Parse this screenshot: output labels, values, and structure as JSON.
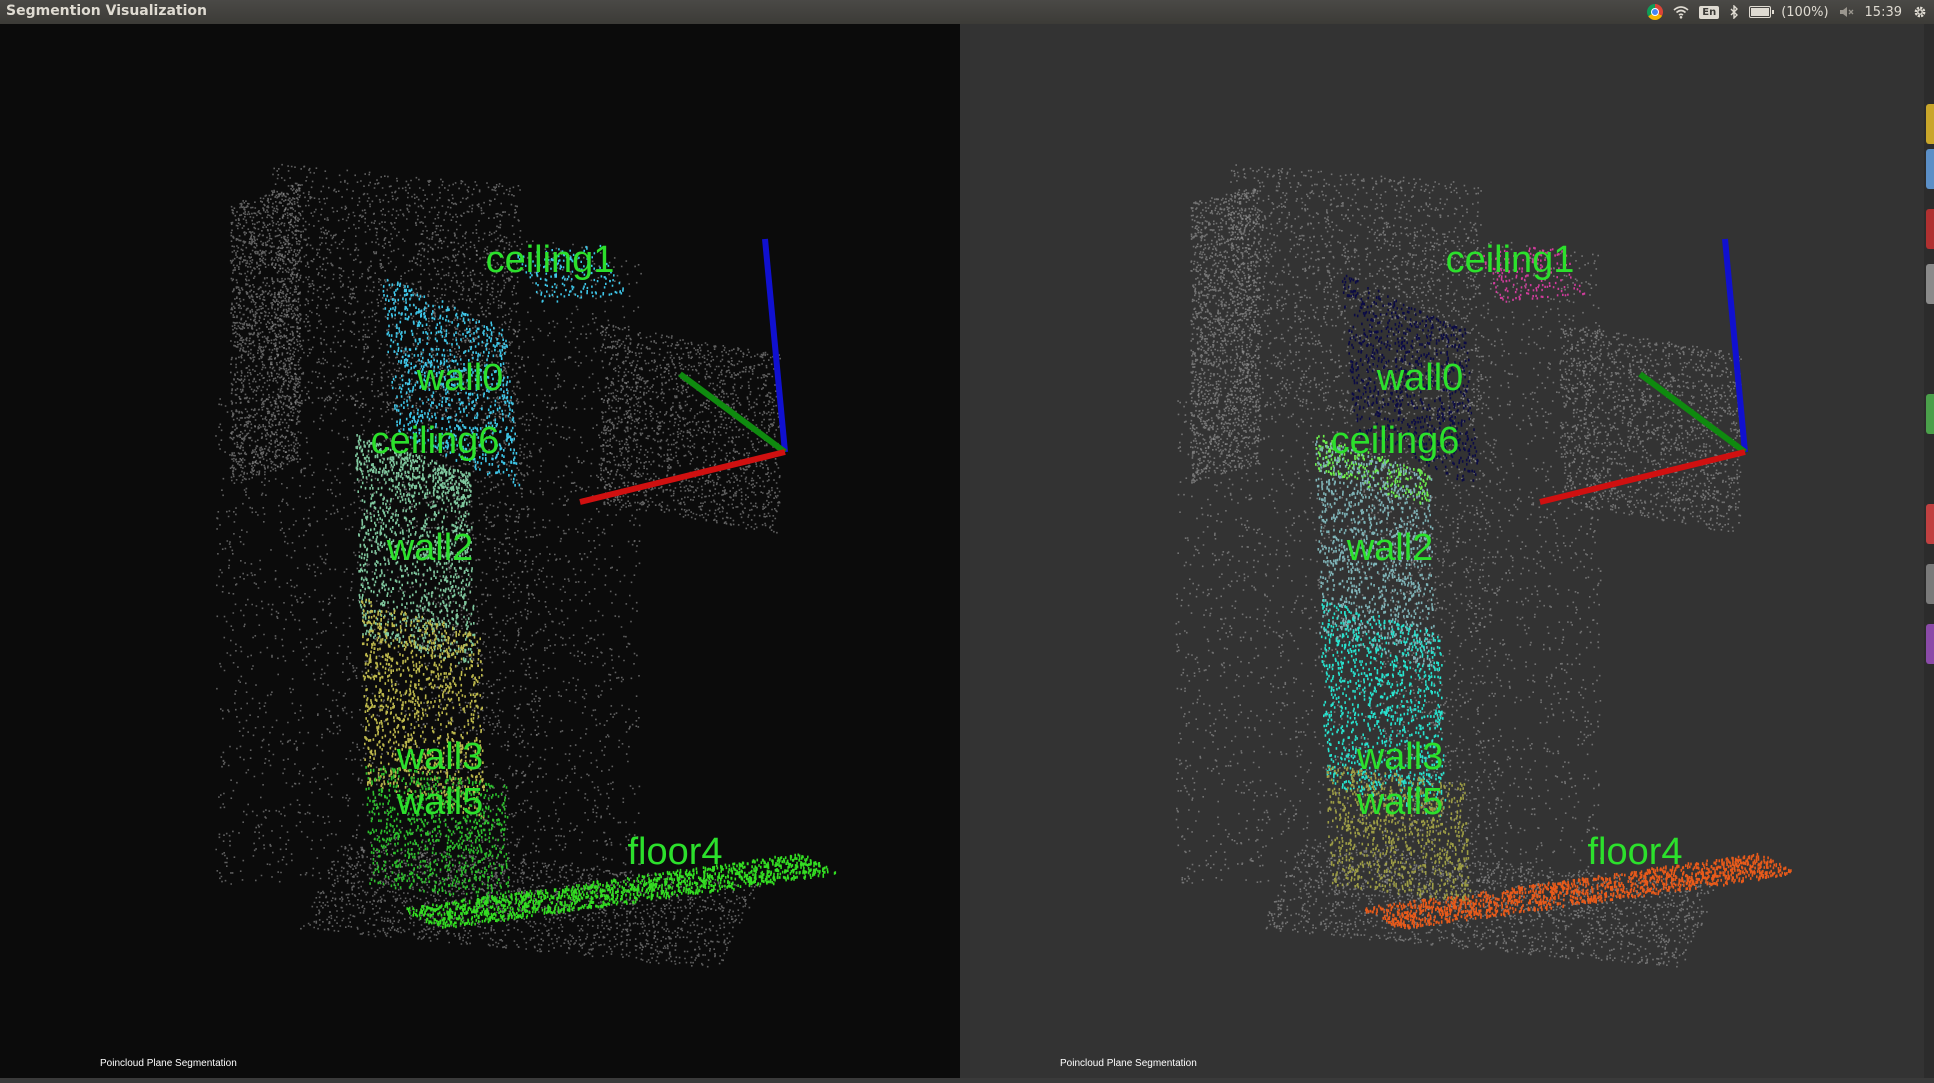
{
  "window": {
    "title": "Segmention Visualization"
  },
  "tray": {
    "keyboard": "En",
    "battery": "(100%)",
    "time": "15:39",
    "icons": [
      "chrome-icon",
      "wifi-icon",
      "keyboard-layout-icon",
      "bluetooth-icon",
      "battery-icon",
      "volume-muted-icon",
      "settings-gear-icon"
    ]
  },
  "viewers": [
    {
      "background": "#0b0b0b",
      "caption": "Poincloud Plane Segmentation",
      "labels": [
        "ceiling1",
        "wall0",
        "ceiling6",
        "wall2",
        "wall3",
        "wall5",
        "floor4"
      ],
      "colors": {
        "wall0": "#3ec6e8",
        "ceiling1": "#3ec6e8",
        "wall2": "#7fc79e",
        "wall3": "#bdb84c",
        "wall5": "#2dbf2d",
        "floor4": "#33dd22"
      }
    },
    {
      "background": "#333333",
      "caption": "Poincloud Plane Segmentation",
      "labels": [
        "ceiling1",
        "wall0",
        "ceiling6",
        "wall2",
        "wall3",
        "wall5",
        "floor4"
      ],
      "colors": {
        "wall0": "#0b0b45",
        "ceiling1": "#d03c9c",
        "ceiling6": "#6cf04c",
        "wall2": "#7fb4b8",
        "wall3": "#27e3cf",
        "wall5": "#9d9d45",
        "floor4": "#e85a1a"
      }
    }
  ],
  "axes_colors": {
    "x": "#d01010",
    "y": "#0f8a0f",
    "z": "#1010d0"
  },
  "label_color": "#2ce02c"
}
